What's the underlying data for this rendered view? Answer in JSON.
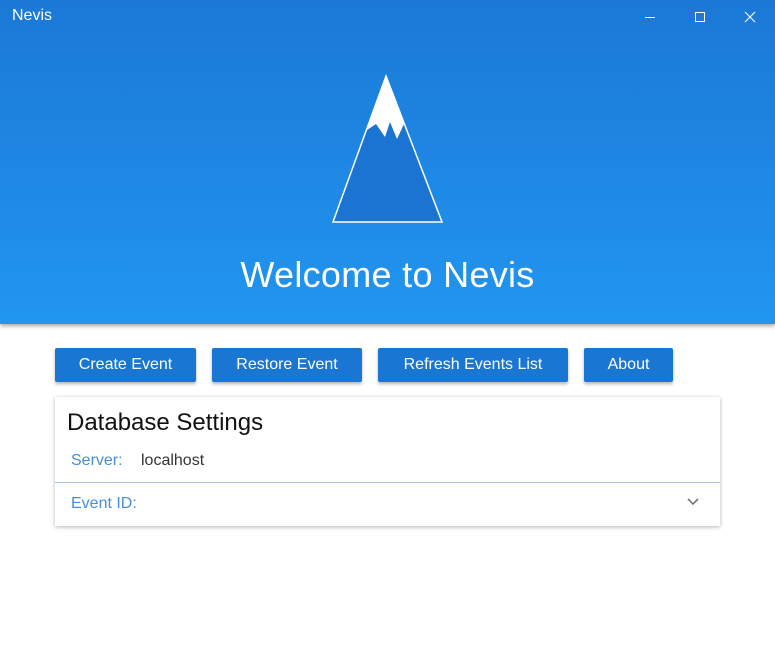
{
  "window": {
    "title": "Nevis",
    "controls": [
      "minimize-icon",
      "maximize-icon",
      "close-icon"
    ]
  },
  "hero": {
    "logo_icon": "mountain-icon",
    "welcome_text": "Welcome to Nevis"
  },
  "toolbar": {
    "create_label": "Create Event",
    "restore_label": "Restore Event",
    "refresh_label": "Refresh Events List",
    "about_label": "About"
  },
  "database": {
    "title": "Database Settings",
    "server_label": "Server:",
    "server_value": "localhost",
    "event_id_label": "Event ID:",
    "event_id_icon": "chevron-down-icon"
  },
  "colors": {
    "header_top": "#1b78d6",
    "header_bottom": "#2196f0",
    "button": "#1976d2",
    "label": "#4a8fd4"
  }
}
